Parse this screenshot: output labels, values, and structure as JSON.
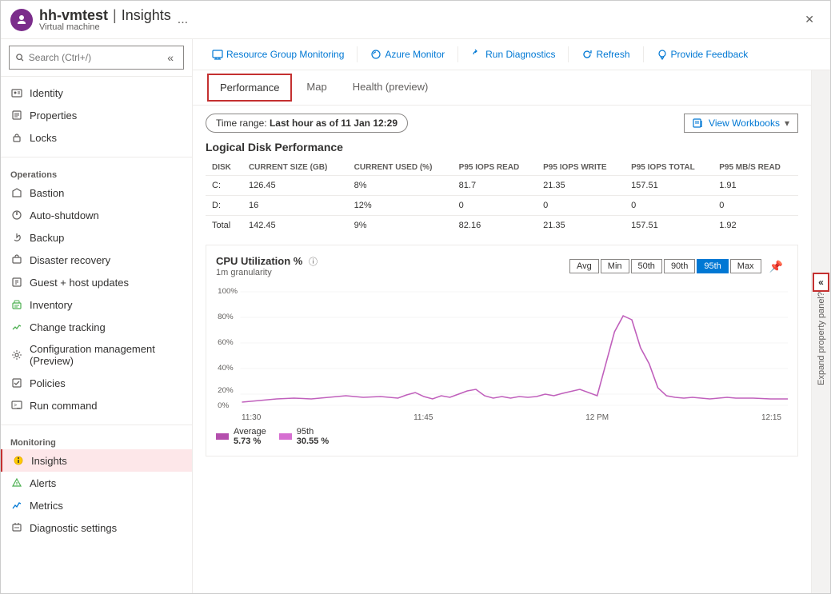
{
  "titleBar": {
    "vmName": "hh-vmtest",
    "separator": "|",
    "pageName": "Insights",
    "subtitle": "Virtual machine",
    "moreLabel": "...",
    "closeLabel": "✕"
  },
  "search": {
    "placeholder": "Search (Ctrl+/)"
  },
  "collapseIcon": "«",
  "sidebar": {
    "items": [
      {
        "id": "identity",
        "label": "Identity",
        "icon": "id-icon",
        "section": null
      },
      {
        "id": "properties",
        "label": "Properties",
        "icon": "props-icon",
        "section": null
      },
      {
        "id": "locks",
        "label": "Locks",
        "icon": "lock-icon",
        "section": null
      }
    ],
    "sections": [
      {
        "title": "Operations",
        "items": [
          {
            "id": "bastion",
            "label": "Bastion",
            "icon": "bastion-icon"
          },
          {
            "id": "auto-shutdown",
            "label": "Auto-shutdown",
            "icon": "shutdown-icon"
          },
          {
            "id": "backup",
            "label": "Backup",
            "icon": "backup-icon"
          },
          {
            "id": "disaster-recovery",
            "label": "Disaster recovery",
            "icon": "disaster-icon"
          },
          {
            "id": "guest-host-updates",
            "label": "Guest + host updates",
            "icon": "updates-icon"
          },
          {
            "id": "inventory",
            "label": "Inventory",
            "icon": "inventory-icon"
          },
          {
            "id": "change-tracking",
            "label": "Change tracking",
            "icon": "tracking-icon"
          },
          {
            "id": "config-mgmt",
            "label": "Configuration management (Preview)",
            "icon": "config-icon"
          },
          {
            "id": "policies",
            "label": "Policies",
            "icon": "policies-icon"
          },
          {
            "id": "run-command",
            "label": "Run command",
            "icon": "run-icon"
          }
        ]
      },
      {
        "title": "Monitoring",
        "items": [
          {
            "id": "insights",
            "label": "Insights",
            "icon": "insights-icon",
            "active": true
          },
          {
            "id": "alerts",
            "label": "Alerts",
            "icon": "alerts-icon"
          },
          {
            "id": "metrics",
            "label": "Metrics",
            "icon": "metrics-icon"
          },
          {
            "id": "diagnostic-settings",
            "label": "Diagnostic settings",
            "icon": "diag-icon"
          }
        ]
      }
    ]
  },
  "toolbar": {
    "buttons": [
      {
        "id": "resource-group",
        "label": "Resource Group Monitoring",
        "icon": "monitor-icon"
      },
      {
        "id": "azure-monitor",
        "label": "Azure Monitor",
        "icon": "azure-icon"
      },
      {
        "id": "run-diagnostics",
        "label": "Run Diagnostics",
        "icon": "diag-run-icon"
      },
      {
        "id": "refresh",
        "label": "Refresh",
        "icon": "refresh-icon"
      },
      {
        "id": "feedback",
        "label": "Provide Feedback",
        "icon": "feedback-icon"
      }
    ]
  },
  "tabs": [
    {
      "id": "performance",
      "label": "Performance",
      "active": true
    },
    {
      "id": "map",
      "label": "Map"
    },
    {
      "id": "health",
      "label": "Health (preview)"
    }
  ],
  "timeRange": {
    "prefix": "Time range:",
    "value": "Last hour as of 11 Jan 12:29"
  },
  "viewWorkbooks": {
    "label": "View Workbooks"
  },
  "diskSection": {
    "title": "Logical Disk Performance",
    "columns": [
      "DISK",
      "CURRENT SIZE (GB)",
      "CURRENT USED (%)",
      "P95 IOPs READ",
      "P95 IOPs WRITE",
      "P95 IOPs TOTAL",
      "P95 MB/s READ"
    ],
    "rows": [
      {
        "disk": "C:",
        "size": "126.45",
        "used": "8%",
        "iopsRead": "81.7",
        "iopsWrite": "21.35",
        "iopsTotal": "157.51",
        "mbsRead": "1.91"
      },
      {
        "disk": "D:",
        "size": "16",
        "used": "12%",
        "iopsRead": "0",
        "iopsWrite": "0",
        "iopsTotal": "0",
        "mbsRead": "0"
      },
      {
        "disk": "Total",
        "size": "142.45",
        "used": "9%",
        "iopsRead": "82.16",
        "iopsWrite": "21.35",
        "iopsTotal": "157.51",
        "mbsRead": "1.92"
      }
    ]
  },
  "cpuSection": {
    "title": "CPU Utilization %",
    "subtitle": "1m granularity",
    "infoIcon": "ℹ",
    "pinIcon": "📌",
    "buttons": [
      "Avg",
      "Min",
      "50th",
      "90th",
      "95th",
      "Max"
    ],
    "activeButton": "95th",
    "chartLabels": [
      "11:30",
      "11:45",
      "12 PM",
      "12:15"
    ],
    "legend": [
      {
        "label": "Average",
        "value": "5.73 %",
        "color": "#b44fad"
      },
      {
        "label": "95th",
        "value": "30.55 %",
        "color": "#d66fd1"
      }
    ]
  },
  "rightPanel": {
    "expandLabel": "Expand property panel?",
    "collapseIcon": "«"
  }
}
